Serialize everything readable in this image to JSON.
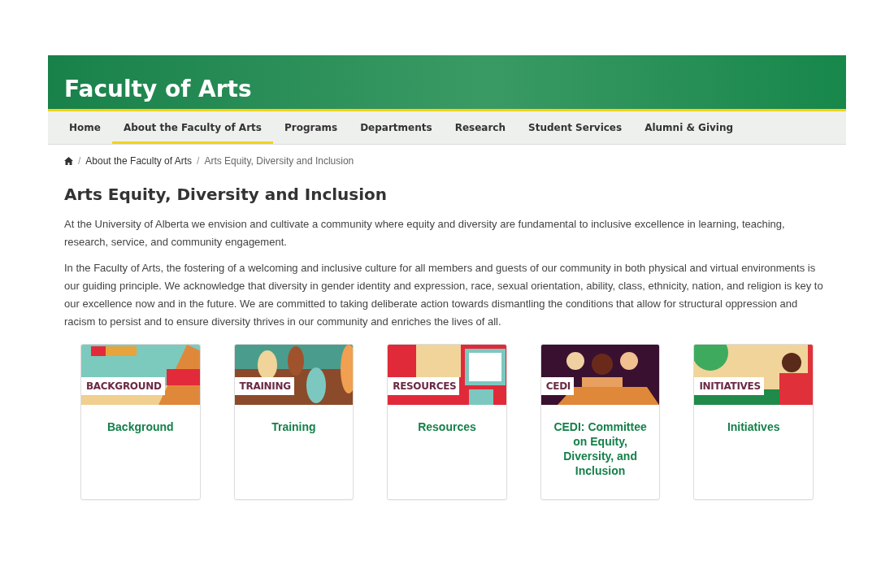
{
  "header": {
    "title": "Faculty of Arts"
  },
  "nav": [
    {
      "label": "Home",
      "selected": false
    },
    {
      "label": "About the Faculty of Arts",
      "selected": true
    },
    {
      "label": "Programs",
      "selected": false
    },
    {
      "label": "Departments",
      "selected": false
    },
    {
      "label": "Research",
      "selected": false
    },
    {
      "label": "Student Services",
      "selected": false
    },
    {
      "label": "Alumni & Giving",
      "selected": false
    }
  ],
  "breadcrumb": [
    "About the Faculty of Arts",
    "Arts Equity, Diversity and Inclusion"
  ],
  "breadcrumb_separator": "/",
  "heading": "Arts Equity, Diversity and Inclusion",
  "paragraphs": [
    "At the University of Alberta we envision and cultivate a community where equity and diversity are fundamental to inclusive excellence in learning, teaching, research, service, and community engagement.",
    "In the Faculty of Arts, the fostering of a welcoming and inclusive culture for all members and guests of our community in both physical and virtual environments is our guiding principle. We acknowledge that diversity in gender identity and expression, race, sexual orientation, ability, class, ethnicity, nation, and religion is key to our excellence now and in the future. We are committed to taking deliberate action towards dismantling the conditions that allow for structural oppression and racism to persist and to ensure diversity thrives in our community and enriches the lives of all."
  ],
  "cards": [
    {
      "kind": "building",
      "banner": "BACKGROUND",
      "title": "Background"
    },
    {
      "kind": "hands",
      "banner": "TRAINING",
      "title": "Training"
    },
    {
      "kind": "screen",
      "banner": "RESOURCES",
      "title": "Resources"
    },
    {
      "kind": "people",
      "banner": "CEDI",
      "title": "CEDI: Committee on Equity, Diversity, and Inclusion"
    },
    {
      "kind": "outdoor",
      "banner": "INITIATIVES",
      "title": "Initiatives"
    }
  ]
}
